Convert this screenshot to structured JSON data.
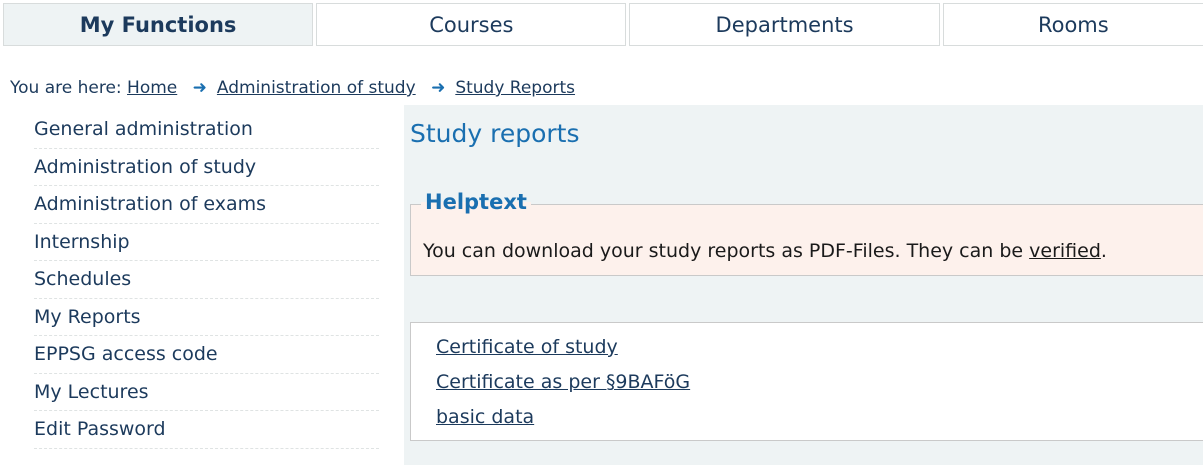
{
  "tabs": [
    {
      "label": "My Functions",
      "active": true
    },
    {
      "label": "Courses",
      "active": false
    },
    {
      "label": "Departments",
      "active": false
    },
    {
      "label": "Rooms",
      "active": false
    }
  ],
  "breadcrumb": {
    "prefix": "You are here:",
    "items": [
      "Home",
      "Administration of study",
      "Study Reports"
    ],
    "separator_icon": "arrow-right-icon"
  },
  "sidebar": {
    "items": [
      {
        "label": "General administration"
      },
      {
        "label": "Administration of study"
      },
      {
        "label": "Administration of exams"
      },
      {
        "label": "Internship"
      },
      {
        "label": "Schedules"
      },
      {
        "label": "My Reports"
      },
      {
        "label": "EPPSG access code"
      },
      {
        "label": "My Lectures"
      },
      {
        "label": "Edit Password"
      }
    ]
  },
  "main": {
    "title": "Study reports",
    "help": {
      "legend": "Helptext",
      "text_before": "You can download your study reports as PDF-Files. They can be ",
      "link": "verified",
      "text_after": "."
    },
    "reports": [
      {
        "label": "Certificate of study"
      },
      {
        "label": "Certificate as per §9BAFöG"
      },
      {
        "label": "basic data"
      }
    ]
  },
  "colors": {
    "accent": "#1a6fb0",
    "navy_text": "#1c3a5c",
    "content_bg": "#eef3f4",
    "help_bg": "#fdf1ec"
  }
}
